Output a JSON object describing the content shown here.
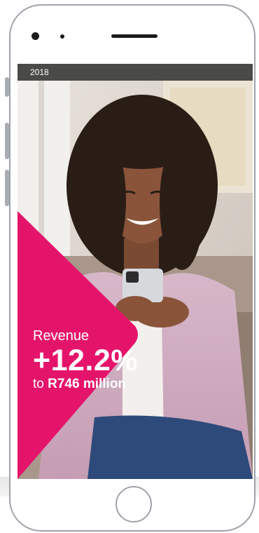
{
  "banner": {
    "year": "2018"
  },
  "highlight": {
    "label": "Revenue",
    "value": "+12.2%",
    "sub_prefix": "to ",
    "sub_amount": "R746 million"
  },
  "colors": {
    "accent": "#e5146b",
    "year_bar": "#4a4a46",
    "frame": "#9ea3aa"
  },
  "icons": {
    "front_camera": "camera-icon",
    "sensor": "sensor-icon",
    "speaker": "speaker-icon",
    "home": "home-button-icon"
  }
}
